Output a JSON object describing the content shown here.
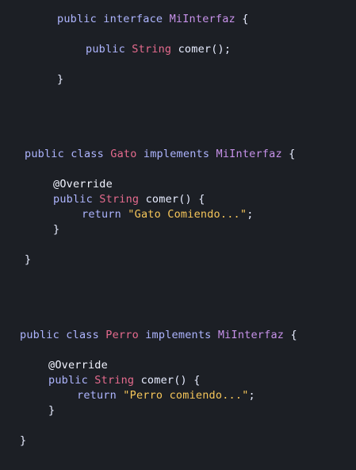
{
  "snippet1": {
    "kw_public": "public",
    "kw_interface": "interface",
    "iface_name": "MiInterfaz",
    "brace_open": "{",
    "m_public": "public",
    "m_type": "String",
    "m_call": "comer();",
    "brace_close": "}"
  },
  "snippet2": {
    "kw_public": "public",
    "kw_class": "class",
    "class_name": "Gato",
    "kw_implements": "implements",
    "iface_name": "MiInterfaz",
    "brace_open": "{",
    "annotation": "@Override",
    "m_public": "public",
    "m_type": "String",
    "m_sig": "comer() {",
    "kw_return": "return",
    "ret_str": "\"Gato Comiendo...\"",
    "semicolon": ";",
    "m_close": "}",
    "brace_close": "}"
  },
  "snippet3": {
    "kw_public": "public",
    "kw_class": "class",
    "class_name": "Perro",
    "kw_implements": "implements",
    "iface_name": "MiInterfaz",
    "brace_open": "{",
    "annotation": "@Override",
    "m_public": "public",
    "m_type": "String",
    "m_sig": "comer() {",
    "kw_return": "return",
    "ret_str": "\"Perro comiendo...\"",
    "semicolon": ";",
    "m_close": "}",
    "brace_close": "}"
  }
}
